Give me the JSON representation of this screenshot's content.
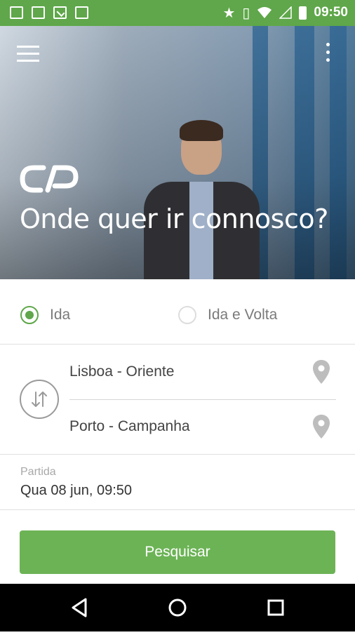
{
  "statusbar": {
    "time": "09:50",
    "icons": [
      "image-icon",
      "photo-icon",
      "download-icon",
      "camera-icon",
      "star-icon",
      "vibrate-icon",
      "wifi-icon",
      "signal-icon",
      "battery-icon"
    ]
  },
  "hero": {
    "title": "Onde quer ir connosco?",
    "logo": "CP",
    "brand_color": "#5fa74a"
  },
  "trip_type": {
    "options": [
      {
        "label": "Ida",
        "selected": true
      },
      {
        "label": "Ida e Volta",
        "selected": false
      }
    ]
  },
  "route": {
    "origin": "Lisboa - Oriente",
    "destination": "Porto - Campanha"
  },
  "departure": {
    "label": "Partida",
    "value": "Qua 08 jun, 09:50"
  },
  "search": {
    "label": "Pesquisar",
    "color": "#6cb356"
  },
  "navbar": {
    "items": [
      "back-icon",
      "home-icon",
      "recents-icon"
    ]
  }
}
